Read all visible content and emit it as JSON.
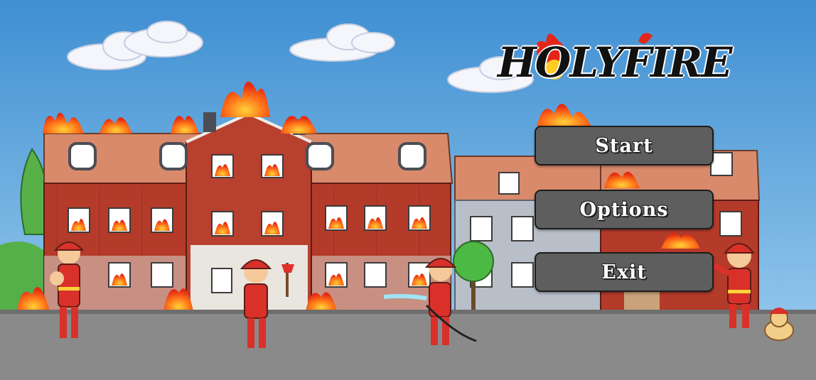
{
  "game": {
    "logo_text": "HOLYFIRE"
  },
  "menu": {
    "start_label": "Start",
    "options_label": "Options",
    "exit_label": "Exit"
  },
  "colors": {
    "sky": "#4f97d4",
    "road": "#8a8a8a",
    "building_red": "#b43a2a",
    "roof": "#d98a6a",
    "button": "#5e5e5e",
    "fire": "#ff5a1f",
    "firefighter": "#d9312a"
  }
}
